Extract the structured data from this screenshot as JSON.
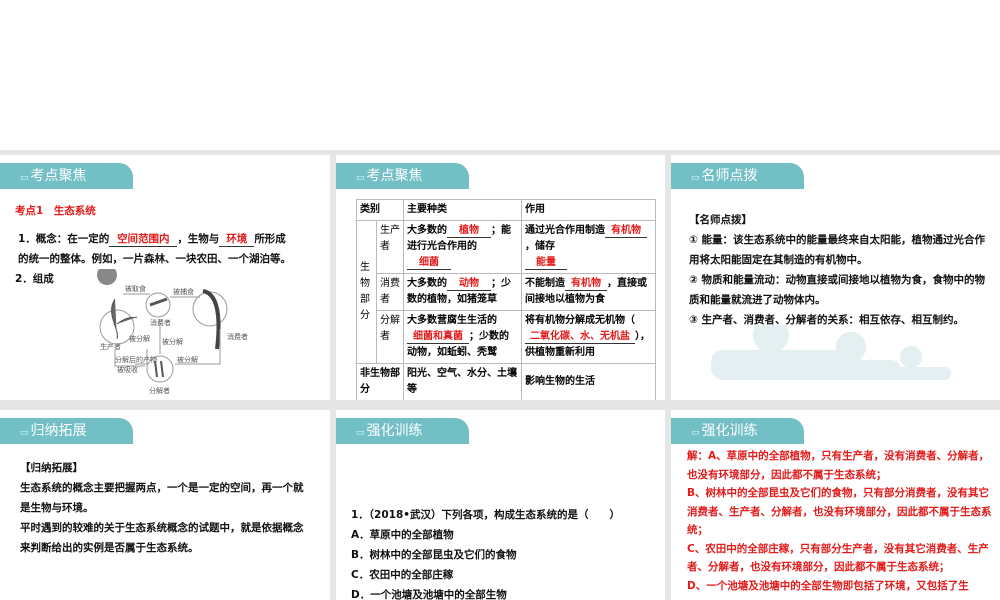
{
  "panels": {
    "p1": {
      "tab": "考点聚焦",
      "heading": "考点1　生态系统",
      "concept_pre": "1．概念：在一定的",
      "blank1": "空间范围内",
      "concept_mid": "，生物与",
      "blank2": "环境",
      "concept_post": "所形成",
      "concept_line2": "的统一的整体。例如，一片森林、一块农田、一个湖泊等。",
      "comp": "2．组成",
      "diagram": {
        "eaten": "被取食",
        "preyed": "被捕食",
        "consumer1": "消费者",
        "consumer2": "消费者",
        "producer": "生产者",
        "decomposer": "分解者",
        "decomp1": "被分解",
        "decomp2": "被分解",
        "decomp3": "被分解",
        "absorbed1": "分解后的产物",
        "absorbed2": "被吸收"
      }
    },
    "p2": {
      "tab": "考点聚焦",
      "table": {
        "h1": "类别",
        "h2": "主要种类",
        "h3": "作用",
        "bio": "生物部分",
        "producer": "生产者",
        "consumer": "消费者",
        "decomposer": "分解者",
        "nonbio": "非生物部分",
        "r1a": "大多数的",
        "r1b1": "植物",
        "r1c": "；能进行光合作用的",
        "r1b2": "细菌",
        "r1d": "通过光合作用制造",
        "r1b3": "有机物",
        "r1e": "，储存",
        "r1b4": "能量",
        "r2a": "大多数的",
        "r2b1": "动物",
        "r2c": "；少数的植物，如猪笼草",
        "r2d": "不能制造",
        "r2b2": "有机物",
        "r2e": "，直接或间接地以植物为食",
        "r3a": "大多数营腐生生活的",
        "r3b1": "细菌和真菌",
        "r3c": "；少数的动物，如蚯蚓、秃鹫",
        "r3d": "将有机物分解成无机物（",
        "r3b2": "二氧化碳、水、无机盐",
        "r3e": "），供植物重新利用",
        "r4a": "阳光、空气、水分、土壤等",
        "r4b": "影响生物的生活"
      }
    },
    "p3": {
      "tab": "名师点拨",
      "title": "【名师点拨】",
      "l1": "① 能量：该生态系统中的能量最终来自太阳能，植物通过光合作用将太阳能固定在其制造的有机物中。",
      "l2": "② 物质和能量流动：动物直接或间接地以植物为食，食物中的物质和能量就流进了动物体内。",
      "l3": "③ 生产者、消费者、分解者的关系：相互依存、相互制约。"
    },
    "p4": {
      "tab": "归纳拓展",
      "title": "【归纳拓展】",
      "l1": "生态系统的概念主要把握两点，一个是一定的空间，再一个就是生物与环境。",
      "l2": "平时遇到的较难的关于生态系统概念的试题中，就是依据概念来判断给出的实例是否属于生态系统。"
    },
    "p5": {
      "tab": "强化训练",
      "q": "1．（2018•武汉）下列各项，构成生态系统的是（　　）",
      "a": "A．草原中的全部植物",
      "b": "B．树林中的全部昆虫及它们的食物",
      "c": "C．农田中的全部庄稼",
      "d": "D．一个池塘及池塘中的全部生物"
    },
    "p6": {
      "tab": "强化训练",
      "a": "解：A、草原中的全部植物，只有生产者，没有消费者、分解者，也没有环境部分，因此都不属于生态系统；",
      "b": "B、树林中的全部昆虫及它们的食物，只有部分消费者，没有其它消费者、生产者、分解者，也没有环境部分，因此都不属于生态系统；",
      "c": "C、农田中的全部庄稼，只有部分生产者，没有其它消费者、生产者、分解者，也没有环境部分，因此都不属于生态系统；",
      "d": "D、一个池塘及池塘中的全部生物即包括了环境，又包括了生"
    }
  }
}
